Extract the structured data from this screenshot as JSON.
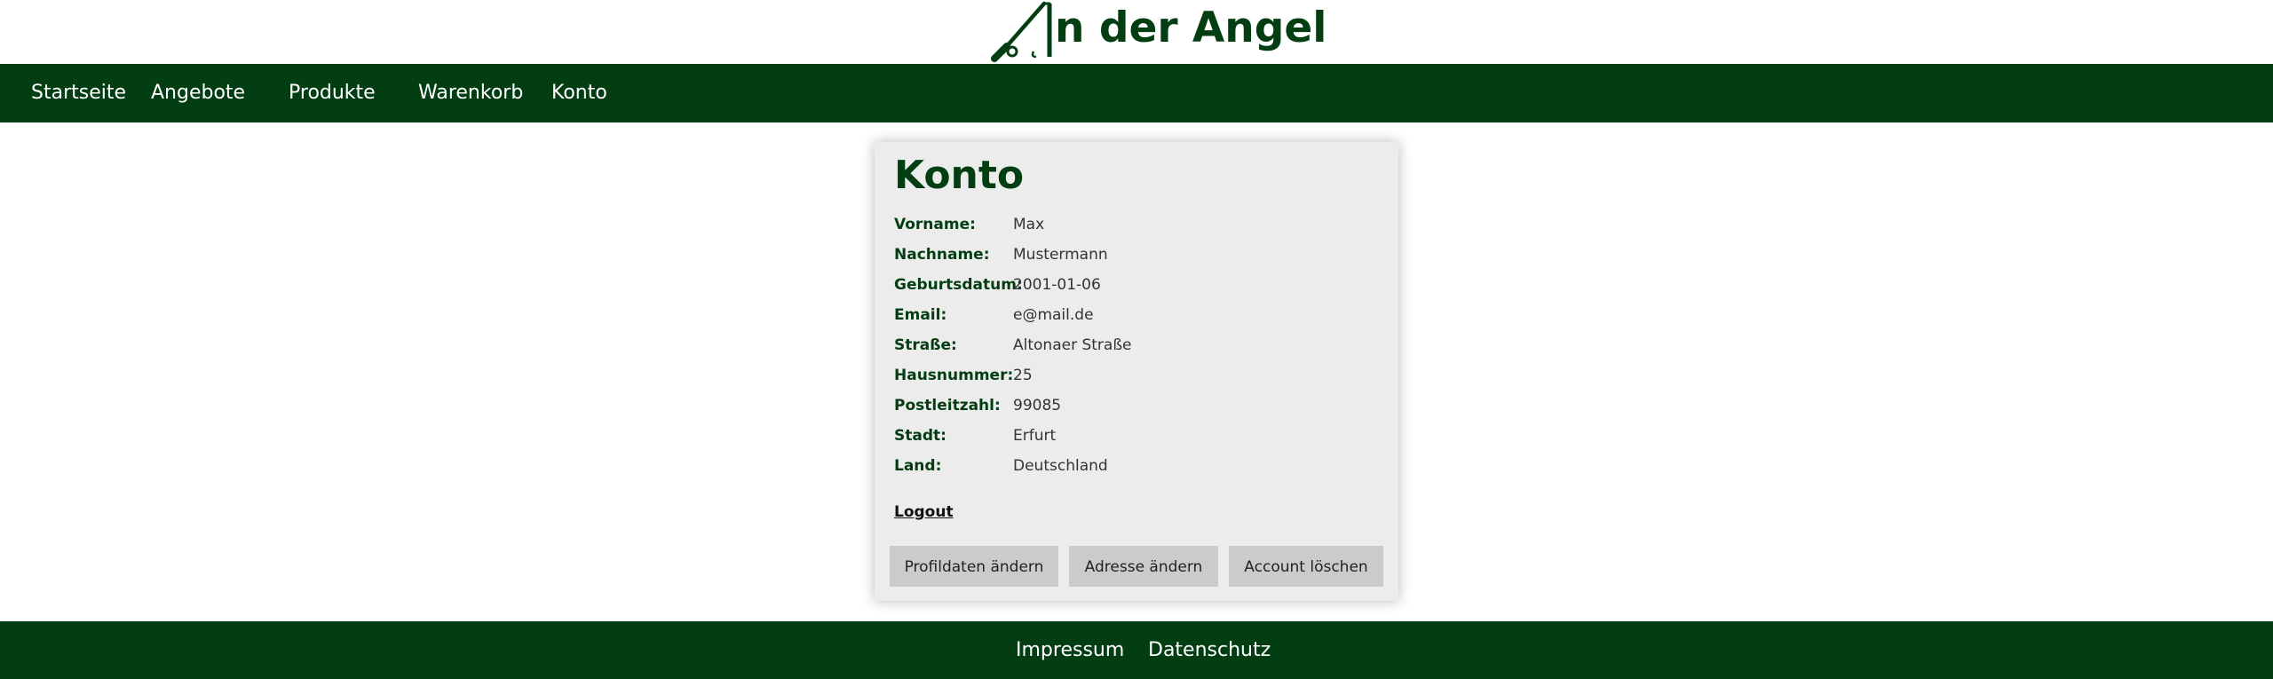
{
  "brand": {
    "logo_text": "n der Angel",
    "primary_color": "#033e12"
  },
  "nav": {
    "items": [
      {
        "label": "Startseite"
      },
      {
        "label": "Angebote"
      },
      {
        "label": "Produkte"
      },
      {
        "label": "Warenkorb"
      },
      {
        "label": "Konto"
      }
    ]
  },
  "account": {
    "title": "Konto",
    "fields": [
      {
        "label": "Vorname:",
        "value": "Max"
      },
      {
        "label": "Nachname:",
        "value": "Mustermann"
      },
      {
        "label": "Geburtsdatum:",
        "value": "2001-01-06"
      },
      {
        "label": "Email:",
        "value": "e@mail.de"
      },
      {
        "label": "Straße:",
        "value": "Altonaer Straße"
      },
      {
        "label": "Hausnummer:",
        "value": "25"
      },
      {
        "label": "Postleitzahl:",
        "value": "99085"
      },
      {
        "label": "Stadt:",
        "value": "Erfurt"
      },
      {
        "label": "Land:",
        "value": "Deutschland"
      }
    ],
    "logout_label": "Logout",
    "buttons": {
      "edit_profile": "Profildaten ändern",
      "edit_address": "Adresse ändern",
      "delete_account": "Account löschen"
    }
  },
  "footer": {
    "impressum": "Impressum",
    "datenschutz": "Datenschutz"
  }
}
